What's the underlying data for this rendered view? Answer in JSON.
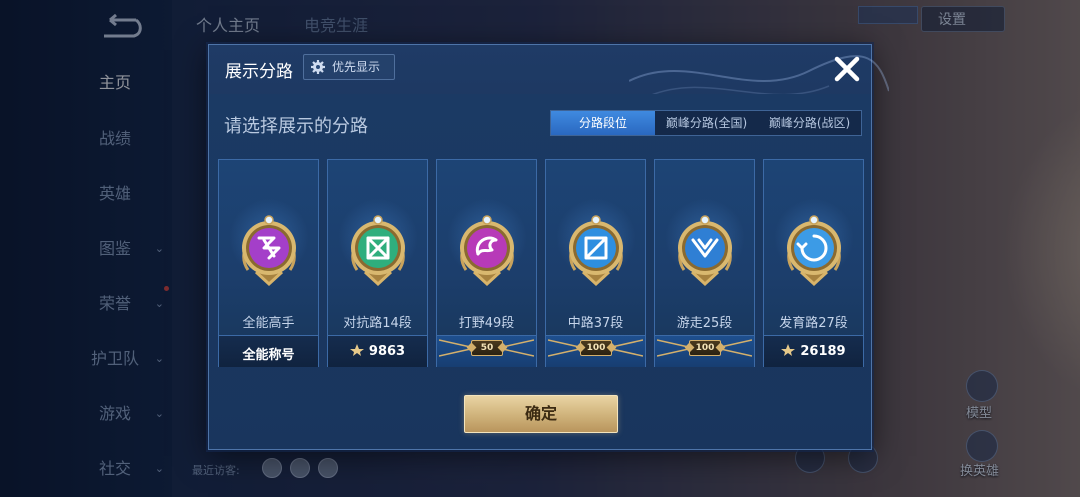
{
  "background": {
    "nav_items": [
      {
        "label": "主页",
        "active": true,
        "chevron": false
      },
      {
        "label": "战绩",
        "active": false,
        "chevron": false
      },
      {
        "label": "英雄",
        "active": false,
        "chevron": false
      },
      {
        "label": "图鉴",
        "active": false,
        "chevron": true
      },
      {
        "label": "荣誉",
        "active": false,
        "chevron": true
      },
      {
        "label": "护卫队",
        "active": false,
        "chevron": true
      },
      {
        "label": "游戏",
        "active": false,
        "chevron": true
      },
      {
        "label": "社交",
        "active": false,
        "chevron": true
      }
    ],
    "top_tabs": [
      {
        "label": "个人主页"
      },
      {
        "label": "电竞生涯"
      }
    ],
    "settings_label": "设置",
    "visitors_label": "最近访客:",
    "right_labels": [
      {
        "label": "模型"
      },
      {
        "label": "换英雄"
      }
    ]
  },
  "modal": {
    "title": "展示分路",
    "priority_label": "优先显示",
    "subtitle": "请选择展示的分路",
    "segments": [
      {
        "label": "分路段位",
        "active": true
      },
      {
        "label": "巅峰分路(全国)",
        "active": false
      },
      {
        "label": "巅峰分路(战区)",
        "active": false
      }
    ],
    "cards": [
      {
        "name": "全能高手",
        "value": "全能称号",
        "type": "text",
        "color": "#a43fc9",
        "icon": "allround-icon"
      },
      {
        "name": "对抗路14段",
        "value": "9863",
        "type": "power",
        "color": "#2fae7d",
        "icon": "clash-lane-icon"
      },
      {
        "name": "打野49段",
        "value": "50",
        "type": "pill",
        "color": "#b73ab8",
        "icon": "jungle-icon"
      },
      {
        "name": "中路37段",
        "value": "100",
        "type": "pill",
        "color": "#2e8fe0",
        "icon": "mid-lane-icon"
      },
      {
        "name": "游走25段",
        "value": "100",
        "type": "pill",
        "color": "#2f7fd4",
        "icon": "roam-icon"
      },
      {
        "name": "发育路27段",
        "value": "26189",
        "type": "power",
        "color": "#3c9be6",
        "icon": "farm-lane-icon"
      }
    ],
    "confirm_label": "确定"
  }
}
